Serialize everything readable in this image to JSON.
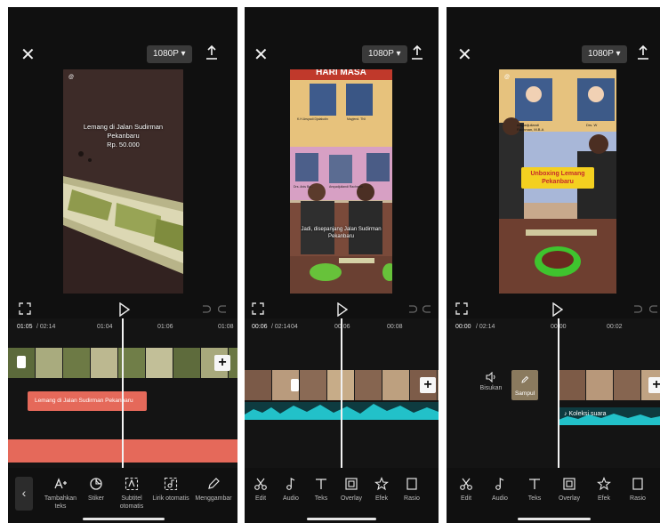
{
  "common": {
    "resolution": "1080P ▾"
  },
  "panel1": {
    "overlay_handle": "@",
    "caption_line1": "Lemang di Jalan Sudirman",
    "caption_line2": "Pekanbaru",
    "caption_line3": "Rp. 50.000",
    "time_current": "01:05",
    "time_total": "/ 02:14",
    "ticks": [
      "01:04",
      "01:06",
      "01:08"
    ],
    "text_clip": "Lemang di Jalan Sudirman Pekanbaru",
    "tools": [
      {
        "icon": "text-add-icon",
        "label": "Tambahkan teks"
      },
      {
        "icon": "sticker-icon",
        "label": "Stiker"
      },
      {
        "icon": "auto-subtitle-icon",
        "label": "Subtitel otomatis"
      },
      {
        "icon": "auto-lyrics-icon",
        "label": "Lirik otomatis"
      },
      {
        "icon": "pencil-icon",
        "label": "Menggambar"
      }
    ]
  },
  "panel2": {
    "banner_text": "HARI MASA",
    "photo_captions": [
      "K.H.Arsyadi Djalaludin",
      "Mayjend. TNI",
      "Arsyadjuliandi Rachman",
      "Drs. Anis Ba..."
    ],
    "caption_line1": "Jadi, disepanjang Jalan Sudirman",
    "caption_line2": "Pekanbaru",
    "time_current": "00:06",
    "time_total": "/ 02:14",
    "ticks": [
      "04",
      "00:06",
      "00:08"
    ],
    "tools": [
      {
        "icon": "scissors-icon",
        "label": "Edit"
      },
      {
        "icon": "music-note-icon",
        "label": "Audio"
      },
      {
        "icon": "text-t-icon",
        "label": "Teks"
      },
      {
        "icon": "overlay-icon",
        "label": "Overlay"
      },
      {
        "icon": "effects-icon",
        "label": "Efek"
      },
      {
        "icon": "ratio-icon",
        "label": "Rasio"
      }
    ]
  },
  "panel3": {
    "overlay_handle": "@",
    "photo_caption1": "Arsyadjuliandi",
    "photo_caption2": "Rachman, M.B.A",
    "photo_caption3": "Drs. W",
    "title_line1": "Unboxing Lemang",
    "title_line2": "Pekanbaru",
    "time_current": "00:00",
    "time_total": "/ 02:14",
    "ticks": [
      "00:00",
      "00:02"
    ],
    "mute_label": "Bisukan",
    "cover_label": "Sampul",
    "audio_label": "Koleksi suara",
    "tools": [
      {
        "icon": "scissors-icon",
        "label": "Edit"
      },
      {
        "icon": "music-note-icon",
        "label": "Audio"
      },
      {
        "icon": "text-t-icon",
        "label": "Teks"
      },
      {
        "icon": "overlay-icon",
        "label": "Overlay"
      },
      {
        "icon": "effects-icon",
        "label": "Efek"
      },
      {
        "icon": "ratio-icon",
        "label": "Rasio"
      }
    ]
  }
}
